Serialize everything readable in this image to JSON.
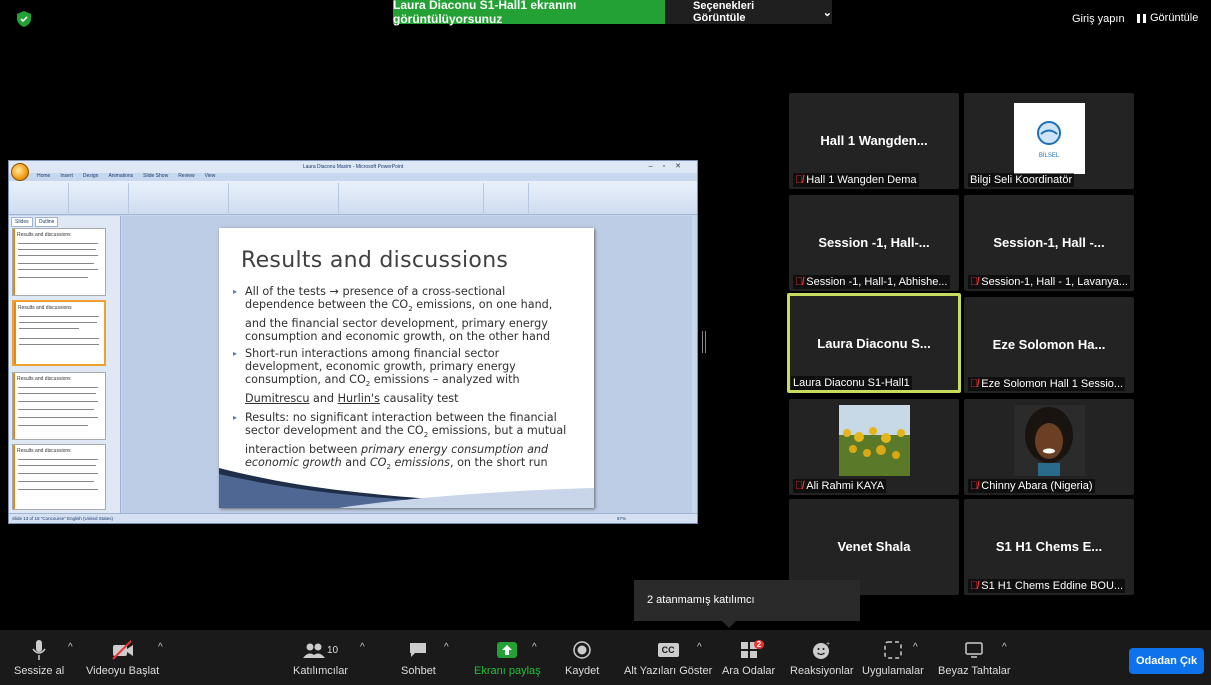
{
  "banner": {
    "sharing_text": "Laura Diaconu S1-Hall1 ekranını görüntülüyorsunuz",
    "view_options": "Seçenekleri Görüntüle"
  },
  "top_right": {
    "login": "Giriş yapın",
    "view": "Görüntüle"
  },
  "shared_screen": {
    "window_title": "Laura Diaconu Maxim - Microsoft PowerPoint",
    "ribbon_tabs": [
      "Home",
      "Insert",
      "Design",
      "Animations",
      "Slide Show",
      "Review",
      "View"
    ],
    "panel_tabs": [
      "Slides",
      "Outline"
    ],
    "thumb_title": "Results and discussions",
    "status": "Slide 13 of 18   \"Concourse\"   English (United States)",
    "zoom": "97%",
    "slide": {
      "title": "Results and discussions",
      "bullets": [
        "All of the tests → presence of a cross-sectional dependence between the CO₂ emissions, on one hand, and the financial sector development, primary energy consumption and economic growth, on the other hand",
        "Short-run interactions among financial sector development, economic growth, primary energy consumption, and CO₂ emissions – analyzed with Dumitrescu and Hurlin's causality test",
        "Results: no significant interaction between the financial sector development and the CO₂ emissions, but a mutual interaction between primary energy consumption and economic growth and CO₂ emissions, on the short run"
      ],
      "b2_pre": "Short-run interactions among financial sector development, economic growth, primary energy consumption, and CO",
      "b2_mid": " emissions – analyzed with ",
      "b2_link1": "Dumitrescu",
      "b2_and": " and ",
      "b2_link2": "Hurlin's",
      "b2_post": " causality test",
      "b3_pre": "Results: no significant interaction between the financial sector development and the CO",
      "b3_mid": " emissions, but a mutual interaction between ",
      "b3_it1": "primary energy consumption and economic growth",
      "b3_and": " and ",
      "b3_it2": "CO",
      "b3_it2b": " emissions",
      "b3_post": ", on the short run",
      "b1_pre": "All of the tests → presence of a cross-sectional dependence between the CO",
      "b1_post": " emissions, on one hand, and the financial sector development, primary energy consumption and economic growth, on the other hand",
      "sub2": "2"
    }
  },
  "tiles": [
    {
      "title": "Hall 1  Wangden...",
      "name": "Hall 1 Wangden Dema",
      "muted": true
    },
    {
      "title": "",
      "name": "Bilgi Seli  Koordinatör",
      "muted": false,
      "logo_text": "BİLSEL"
    },
    {
      "title": "Session -1, Hall-...",
      "name": "Session -1, Hall-1, Abhishe...",
      "muted": true
    },
    {
      "title": "Session-1, Hall -...",
      "name": "Session-1, Hall - 1, Lavanya...",
      "muted": true
    },
    {
      "title": "Laura Diaconu S...",
      "name": "Laura Diaconu S1-Hall1",
      "muted": false
    },
    {
      "title": "Eze Solomon Ha...",
      "name": "Eze Solomon Hall 1 Sessio...",
      "muted": true
    },
    {
      "title": "",
      "name": "Ali Rahmi KAYA",
      "muted": true
    },
    {
      "title": "",
      "name": "Chinny Abara (Nigeria)",
      "muted": true
    },
    {
      "title": "Venet Shala",
      "name": "",
      "muted": false
    },
    {
      "title": "S1 H1  Chems E...",
      "name": "S1 H1  Chems Eddine BOU...",
      "muted": true
    }
  ],
  "tooltip": "2 atanmamış katılımcı",
  "toolbar": {
    "mute": "Sessize al",
    "video": "Videoyu Başlat",
    "participants": "Katılımcılar",
    "participants_count": "10",
    "chat": "Sohbet",
    "share": "Ekranı paylaş",
    "record": "Kaydet",
    "captions": "Alt Yazıları Göster",
    "captions_icon": "CC",
    "breakout": "Ara Odalar",
    "breakout_badge": "2",
    "reactions": "Reaksiyonlar",
    "apps": "Uygulamalar",
    "whiteboard": "Beyaz Tahtalar",
    "leave": "Odadan Çık"
  },
  "colors": {
    "share_green": "#23a135",
    "leave_blue": "#0e72ed",
    "active_border": "#c9db5c",
    "muted_red": "#e33333"
  }
}
